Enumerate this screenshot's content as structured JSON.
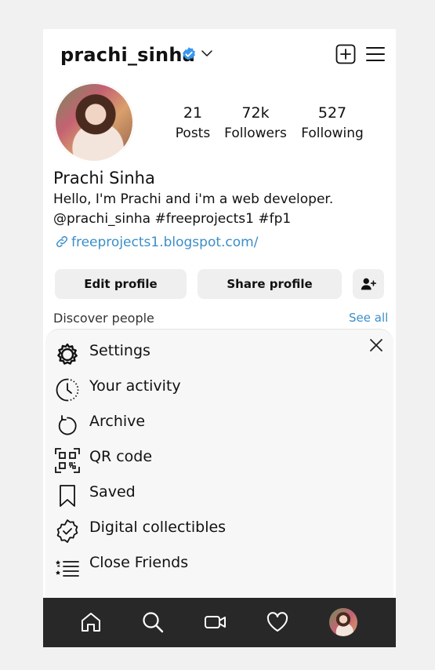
{
  "profile": {
    "username": "prachi_sinha",
    "full_name": "Prachi Sinha",
    "bio_line1": "Hello, I'm Prachi and i'm a web developer.",
    "bio_line2": "@prachi_sinha #freeprojects1 #fp1",
    "link": "freeprojects1.blogspot.com/",
    "verified": true
  },
  "stats": {
    "posts": {
      "value": "21",
      "label": "Posts"
    },
    "followers": {
      "value": "72k",
      "label": "Followers"
    },
    "following": {
      "value": "527",
      "label": "Following"
    }
  },
  "actions": {
    "edit": "Edit profile",
    "share": "Share profile"
  },
  "discover": {
    "title": "Discover people",
    "see_all": "See all"
  },
  "menu": {
    "items": [
      {
        "label": "Settings",
        "icon": "gear-icon"
      },
      {
        "label": "Your activity",
        "icon": "activity-icon"
      },
      {
        "label": "Archive",
        "icon": "archive-icon"
      },
      {
        "label": "QR code",
        "icon": "qr-code-icon"
      },
      {
        "label": "Saved",
        "icon": "bookmark-icon"
      },
      {
        "label": "Digital collectibles",
        "icon": "collectibles-icon"
      },
      {
        "label": "Close Friends",
        "icon": "close-friends-icon"
      }
    ]
  },
  "colors": {
    "accent_link": "#3b8ec9",
    "verified_badge": "#3897f0",
    "tabbar": "#282828",
    "button_bg": "#efefef"
  }
}
